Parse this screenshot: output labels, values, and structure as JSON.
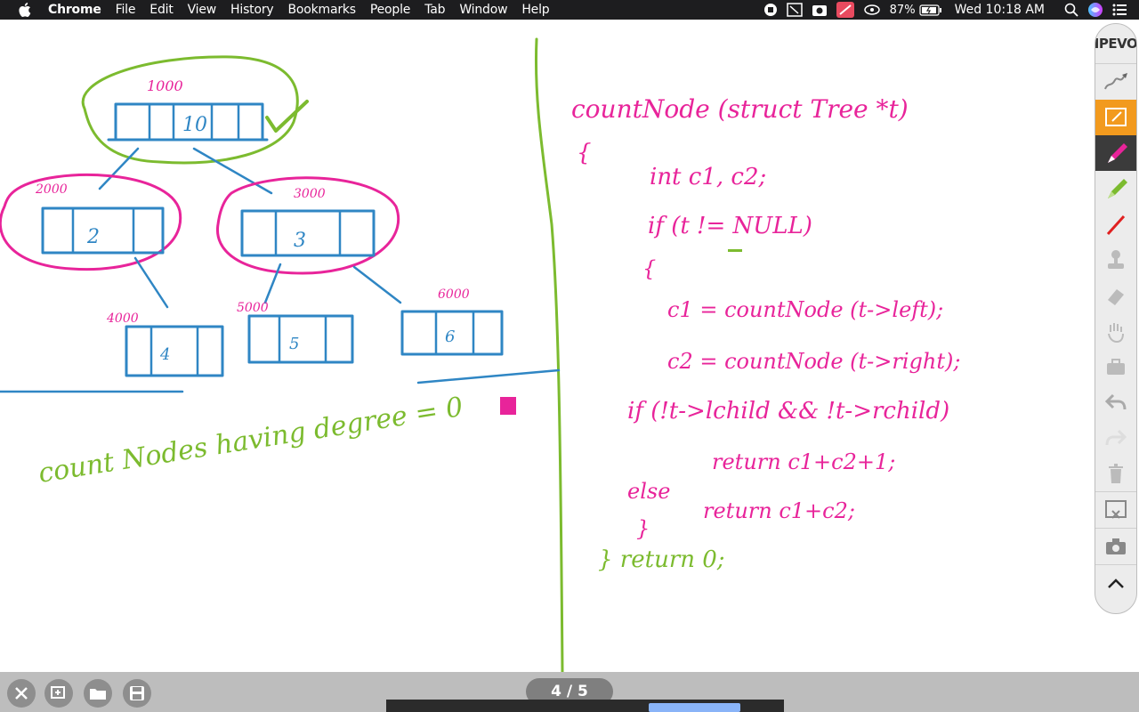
{
  "menubar": {
    "apple_icon": "apple-logo-icon",
    "app_name": "Chrome",
    "menus": [
      "File",
      "Edit",
      "View",
      "History",
      "Bookmarks",
      "People",
      "Tab",
      "Window",
      "Help"
    ],
    "battery": "87%",
    "clock": "Wed 10:18 AM"
  },
  "toolbar": {
    "brand": "IPEVO",
    "tools": [
      "pen-icon",
      "select-area-icon",
      "pen-pink-icon",
      "pen-green-icon",
      "pen-red-icon",
      "stamp-icon",
      "eraser-icon",
      "hand-icon",
      "toolbox-icon",
      "undo-icon",
      "redo-icon",
      "trash-icon",
      "snapshot-icon",
      "camera-icon",
      "collapse-up-icon"
    ],
    "accent_orange": "#f29a1e"
  },
  "whiteboard": {
    "tree_nodes": [
      "10",
      "2",
      "3",
      "4",
      "5",
      "6"
    ],
    "tree_addresses": [
      "1000",
      "2000",
      "3000",
      "4000",
      "5000",
      "6000"
    ],
    "caption": "count Nodes having degree = 0",
    "code_lines": [
      "countNode (struct Tree *t)",
      "{",
      "int c1, c2;",
      "if (t != NULL)",
      "{",
      "c1 = countNode (t->left);",
      "c2 = countNode (t->right);",
      "if (!t->lchild && !t->rchild)",
      "return c1+c2+1;",
      "else",
      "return c1+c2;",
      "}",
      "} return 0;"
    ],
    "colors": {
      "pink": "#e8249a",
      "green": "#7cbb2f",
      "blue": "#2f86c4"
    }
  },
  "bottombar": {
    "page_indicator": "4 / 5",
    "buttons": [
      "close-icon",
      "new-page-icon",
      "open-folder-icon",
      "save-icon"
    ]
  }
}
